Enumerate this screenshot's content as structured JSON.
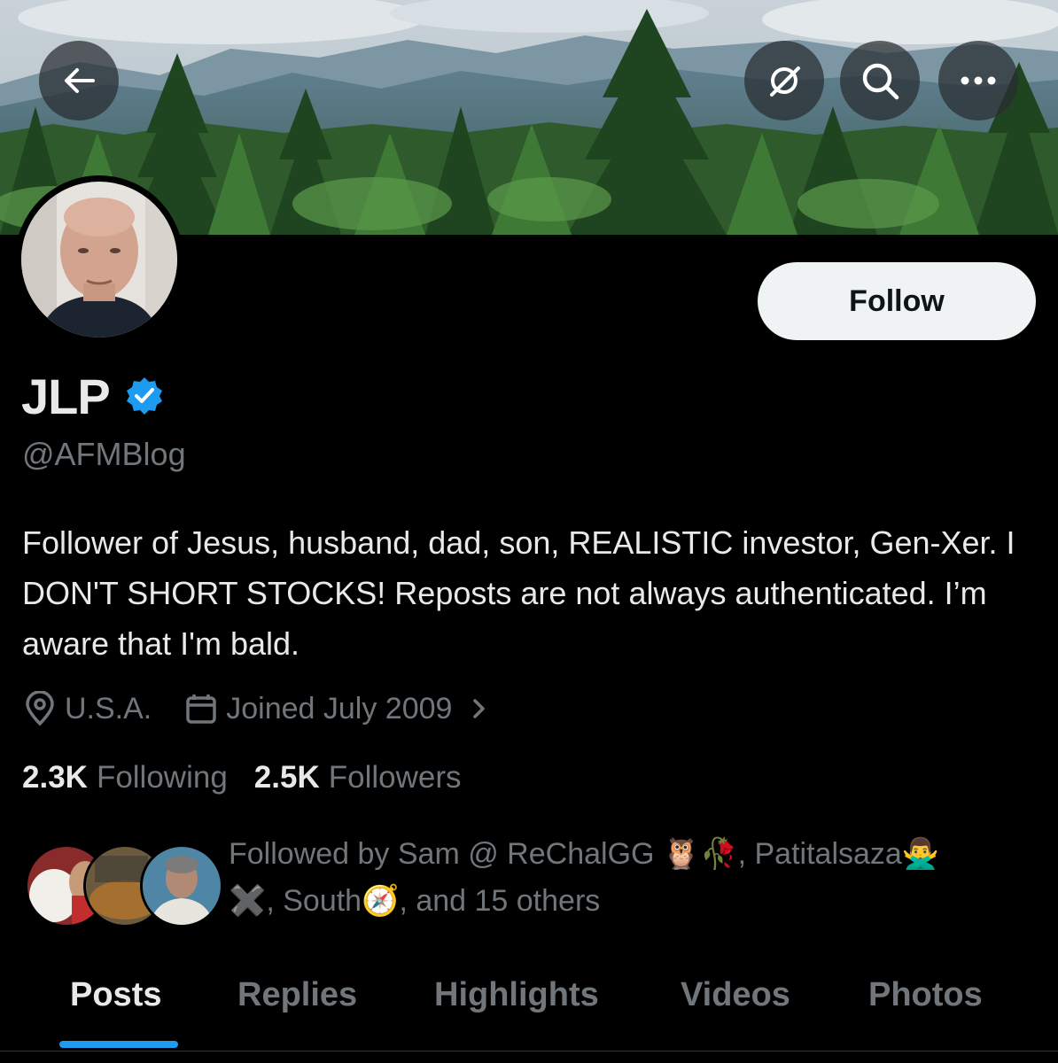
{
  "banner": {
    "description_icon": "mountain-forest-banner"
  },
  "header_buttons": {
    "back": "back-arrow-icon",
    "grok": "grok-icon",
    "search": "search-icon",
    "more": "more-icon"
  },
  "profile": {
    "display_name": "JLP",
    "verified": true,
    "handle": "@AFMBlog",
    "bio": "Follower of Jesus, husband, dad, son, REALISTIC investor, Gen-Xer. I DON'T SHORT STOCKS! Reposts are not always authenticated. I’m aware that I'm bald.",
    "location": "U.S.A.",
    "joined": "Joined July 2009",
    "following_count": "2.3K",
    "following_label": "Following",
    "followers_count": "2.5K",
    "followers_label": "Followers"
  },
  "follow_button": {
    "label": "Follow"
  },
  "followed_by": {
    "prefix": "Followed by Sam @ ReChalGG ",
    "emoji_1": "🦉",
    "emoji_2": "🥀",
    "sep_1": ", Patitalsaza",
    "emoji_3": "🙅‍♂️",
    "emoji_4": "✖️",
    "sep_2": ", South",
    "emoji_5": "🧭",
    "suffix": ", and 15 others"
  },
  "tabs": [
    {
      "label": "Posts",
      "active": true
    },
    {
      "label": "Replies",
      "active": false
    },
    {
      "label": "Highlights",
      "active": false
    },
    {
      "label": "Videos",
      "active": false
    },
    {
      "label": "Photos",
      "active": false
    }
  ],
  "colors": {
    "background": "#000000",
    "text_primary": "#e7e9ea",
    "text_secondary": "#71767b",
    "accent": "#1d9bf0",
    "follow_bg": "#eff3f4"
  }
}
